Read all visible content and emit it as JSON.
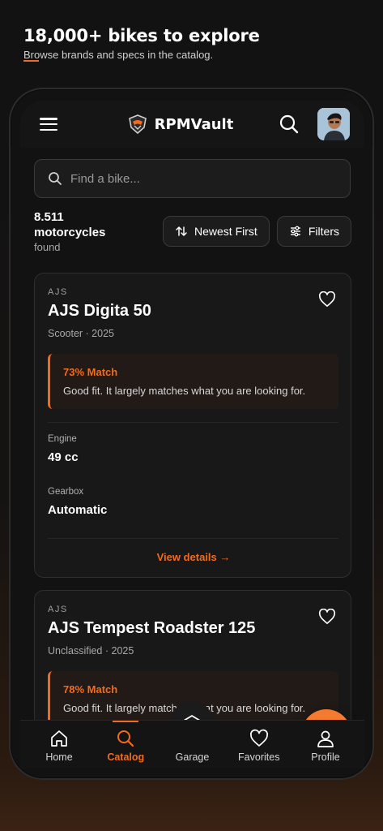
{
  "promo": {
    "title": "18,000+ bikes to explore",
    "subtitle": "Browse brands and specs in the catalog."
  },
  "header": {
    "app_name": "RPMVault"
  },
  "search": {
    "placeholder": "Find a bike..."
  },
  "results": {
    "count": "8.511",
    "label": "motorcycles",
    "found": "found"
  },
  "sort": {
    "label": "Newest First"
  },
  "filters": {
    "label": "Filters"
  },
  "cards": [
    {
      "brand": "AJS",
      "model": "AJS Digita 50",
      "meta": "Scooter · 2025",
      "match_title": "73% Match",
      "match_text": "Good fit. It largely matches what you are looking for.",
      "engine_label": "Engine",
      "engine_value": "49 cc",
      "gearbox_label": "Gearbox",
      "gearbox_value": "Automatic",
      "details_label": "View details →"
    },
    {
      "brand": "AJS",
      "model": "AJS Tempest Roadster 125",
      "meta": "Unclassified · 2025",
      "match_title": "78% Match",
      "match_text": "Good fit. It largely matches what you are looking for."
    }
  ],
  "tabs": [
    {
      "label": "Home",
      "icon": "home-icon"
    },
    {
      "label": "Catalog",
      "icon": "search-icon"
    },
    {
      "label": "Garage",
      "icon": "garage-icon"
    },
    {
      "label": "Favorites",
      "icon": "heart-icon"
    },
    {
      "label": "Profile",
      "icon": "user-icon"
    }
  ],
  "colors": {
    "accent": "#f26b1d",
    "background": "#121212",
    "card": "#181818"
  }
}
